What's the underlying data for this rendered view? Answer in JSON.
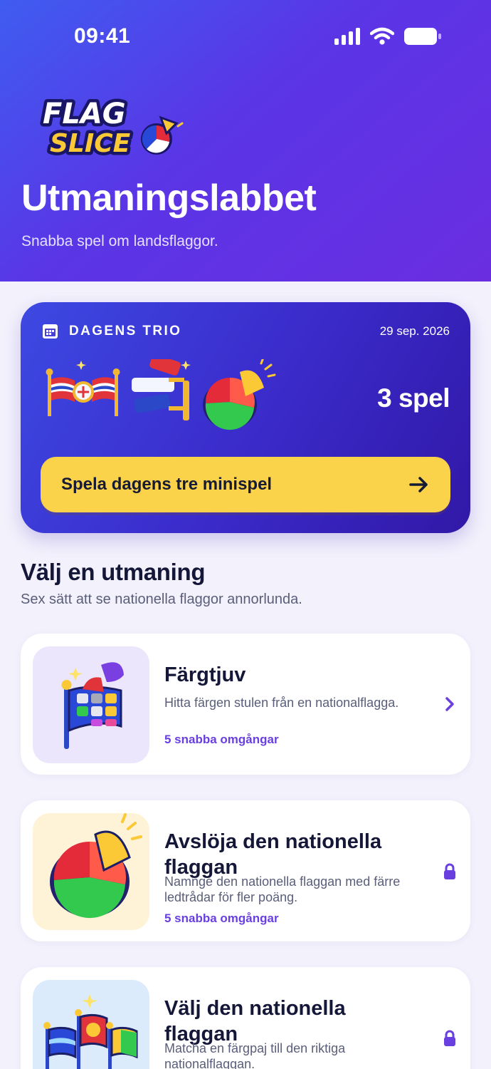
{
  "status_bar": {
    "time": "09:41"
  },
  "brand": {
    "logo_text_top": "FLAG",
    "logo_text_bottom": "SLICE"
  },
  "header": {
    "title": "Utmaningslabbet",
    "subtitle": "Snabba spel om landsflaggor."
  },
  "daily": {
    "label": "DAGENS TRIO",
    "date": "29 sep. 2026",
    "count": "3 spel",
    "button_label": "Spela dagens tre minispel"
  },
  "section": {
    "title": "Välj en utmaning",
    "subtitle": "Sex sätt att se nationella flaggor annorlunda."
  },
  "challenges": [
    {
      "title": "Färgtjuv",
      "description": "Hitta färgen stulen från en nationalflagga.",
      "rounds": "5 snabba omgångar",
      "status": "open",
      "trailing_icon": "chevron-right-icon"
    },
    {
      "title": "Avslöja den nationella flaggan",
      "description": "Namnge den nationella flaggan med färre ledtrådar för fler poäng.",
      "rounds": "5 snabba omgångar",
      "status": "locked",
      "trailing_icon": "lock-icon"
    },
    {
      "title": "Välj den nationella flaggan",
      "description": "Matcha en färgpaj till den riktiga nationalflaggan.",
      "status": "locked",
      "trailing_icon": "lock-icon"
    }
  ],
  "colors": {
    "hero_gradient": [
      "#3f5cf0",
      "#6a2ee0"
    ],
    "accent": "#6a3fe0",
    "button_yellow": "#fbd34b",
    "page_bg": "#f3f1fc"
  }
}
